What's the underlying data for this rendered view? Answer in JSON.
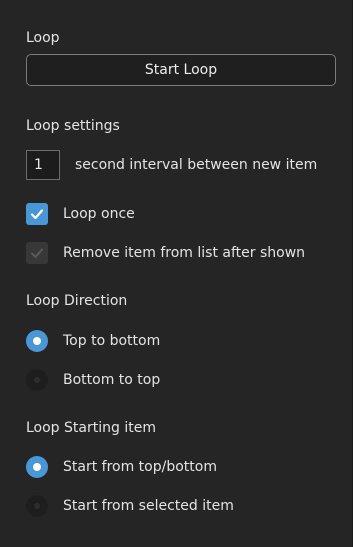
{
  "loop": {
    "section_label": "Loop",
    "start_button_label": "Start Loop"
  },
  "settings": {
    "section_label": "Loop settings",
    "interval_value": "1",
    "interval_label": "second interval between new item",
    "loop_once": {
      "label": "Loop once",
      "checked": true
    },
    "remove_item": {
      "label": "Remove item from list after shown",
      "checked": true,
      "disabled": true
    }
  },
  "direction": {
    "section_label": "Loop Direction",
    "options": [
      {
        "label": "Top to bottom",
        "selected": true
      },
      {
        "label": "Bottom to top",
        "selected": false
      }
    ]
  },
  "starting_item": {
    "section_label": "Loop Starting item",
    "options": [
      {
        "label": "Start from top/bottom",
        "selected": true
      },
      {
        "label": "Start from selected item",
        "selected": false
      }
    ]
  },
  "colors": {
    "accent": "#4a97d8",
    "background": "#252525",
    "text": "#e4e4e4"
  },
  "icons": {
    "check": "checkmark-icon",
    "radio_selected": "radio-selected-icon",
    "radio_unselected": "radio-unselected-icon"
  }
}
